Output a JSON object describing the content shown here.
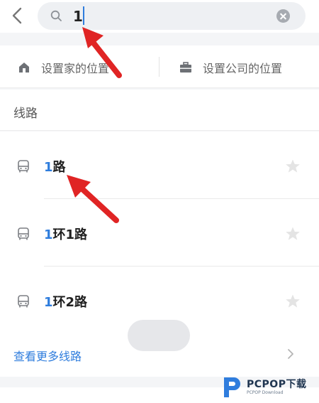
{
  "search": {
    "query": "1"
  },
  "places": {
    "home_label": "设置家的位置",
    "work_label": "设置公司的位置"
  },
  "section": {
    "title": "线路"
  },
  "routes": [
    {
      "highlight": "1",
      "rest": "路"
    },
    {
      "highlight": "1",
      "rest": "环1路"
    },
    {
      "highlight": "1",
      "rest": "环2路"
    }
  ],
  "more": {
    "label": "查看更多线路"
  },
  "watermark": {
    "brand": "PCPOP下载",
    "sub": "PCPOP Download"
  },
  "colors": {
    "accent": "#2f7ddd",
    "annotation_arrow": "#e02424"
  }
}
